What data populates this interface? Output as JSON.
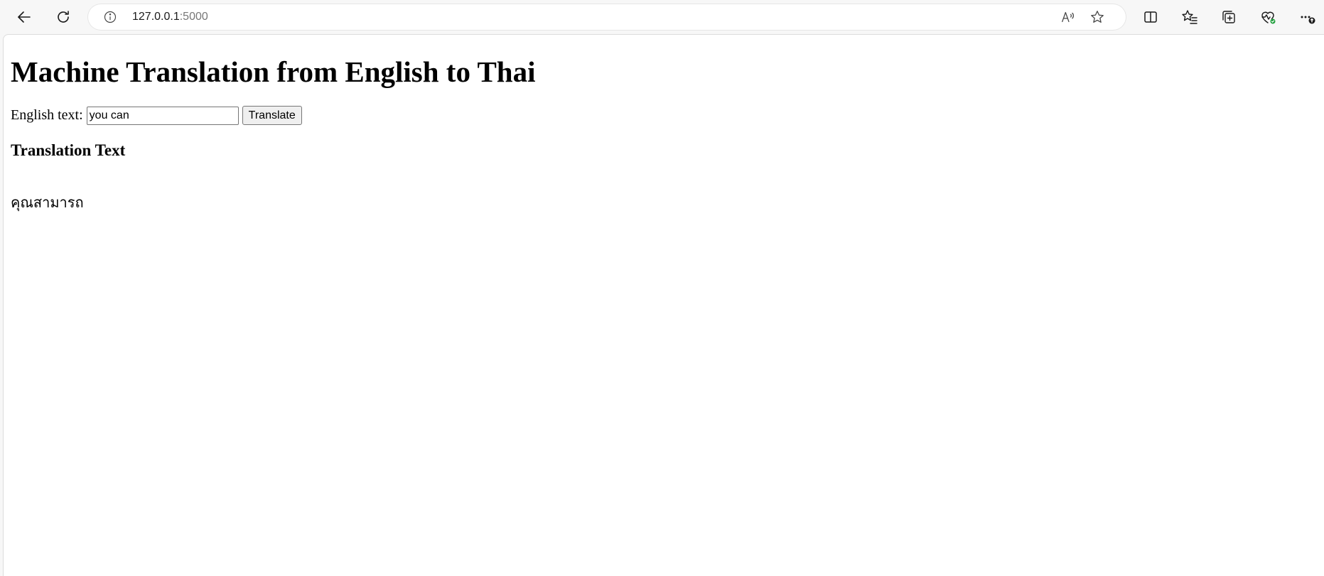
{
  "browser": {
    "url_host": "127.0.0.1",
    "url_port": ":5000",
    "toolbar_icons": [
      "back-icon",
      "refresh-icon",
      "info-icon",
      "read-aloud-icon",
      "favorite-star-icon",
      "split-screen-icon",
      "favorites-icon",
      "collections-icon",
      "browser-essentials-icon",
      "more-icon"
    ]
  },
  "page": {
    "title": "Machine Translation from English to Thai",
    "form": {
      "label": "English text:",
      "input_value": "you can",
      "button_label": "Translate"
    },
    "result_heading": "Translation Text",
    "result_text": "คุณสามารถ"
  }
}
